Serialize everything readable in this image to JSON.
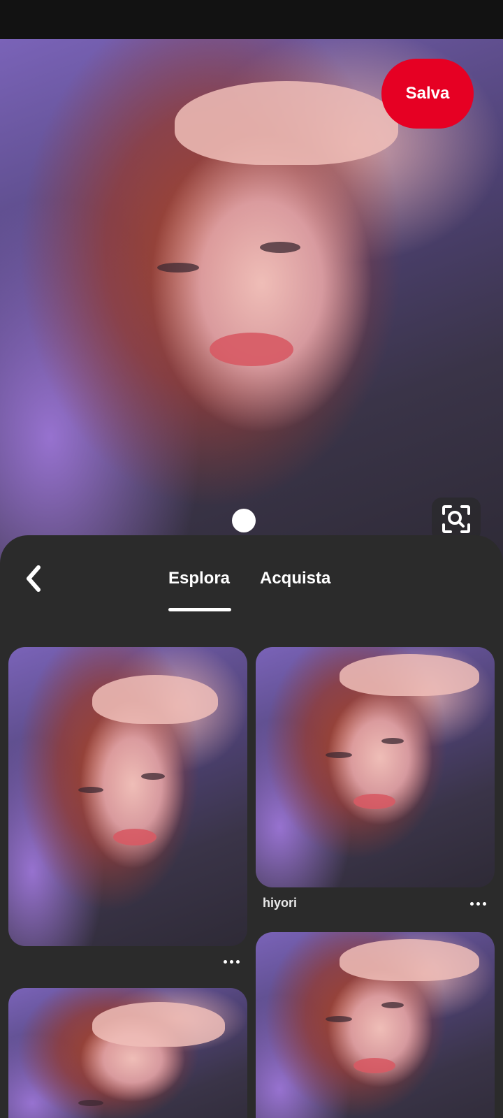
{
  "hero": {
    "save_label": "Salva",
    "image_alt": "Close-up photo of a red-haired woman lying down with one eye closed, hand on her forehead"
  },
  "tabs": [
    {
      "label": "Esplora",
      "active": true
    },
    {
      "label": "Acquista",
      "active": false
    }
  ],
  "pins": [
    {
      "author": ""
    },
    {
      "author": "hiyori"
    },
    {
      "author": ""
    },
    {
      "author": ""
    }
  ],
  "colors": {
    "brand_red": "#e60023",
    "sheet_bg": "#2b2b2b",
    "text": "#ffffff"
  },
  "icons": {
    "back": "chevron-left-icon",
    "visual_search": "visual-search-icon",
    "more": "more-dots-icon"
  }
}
